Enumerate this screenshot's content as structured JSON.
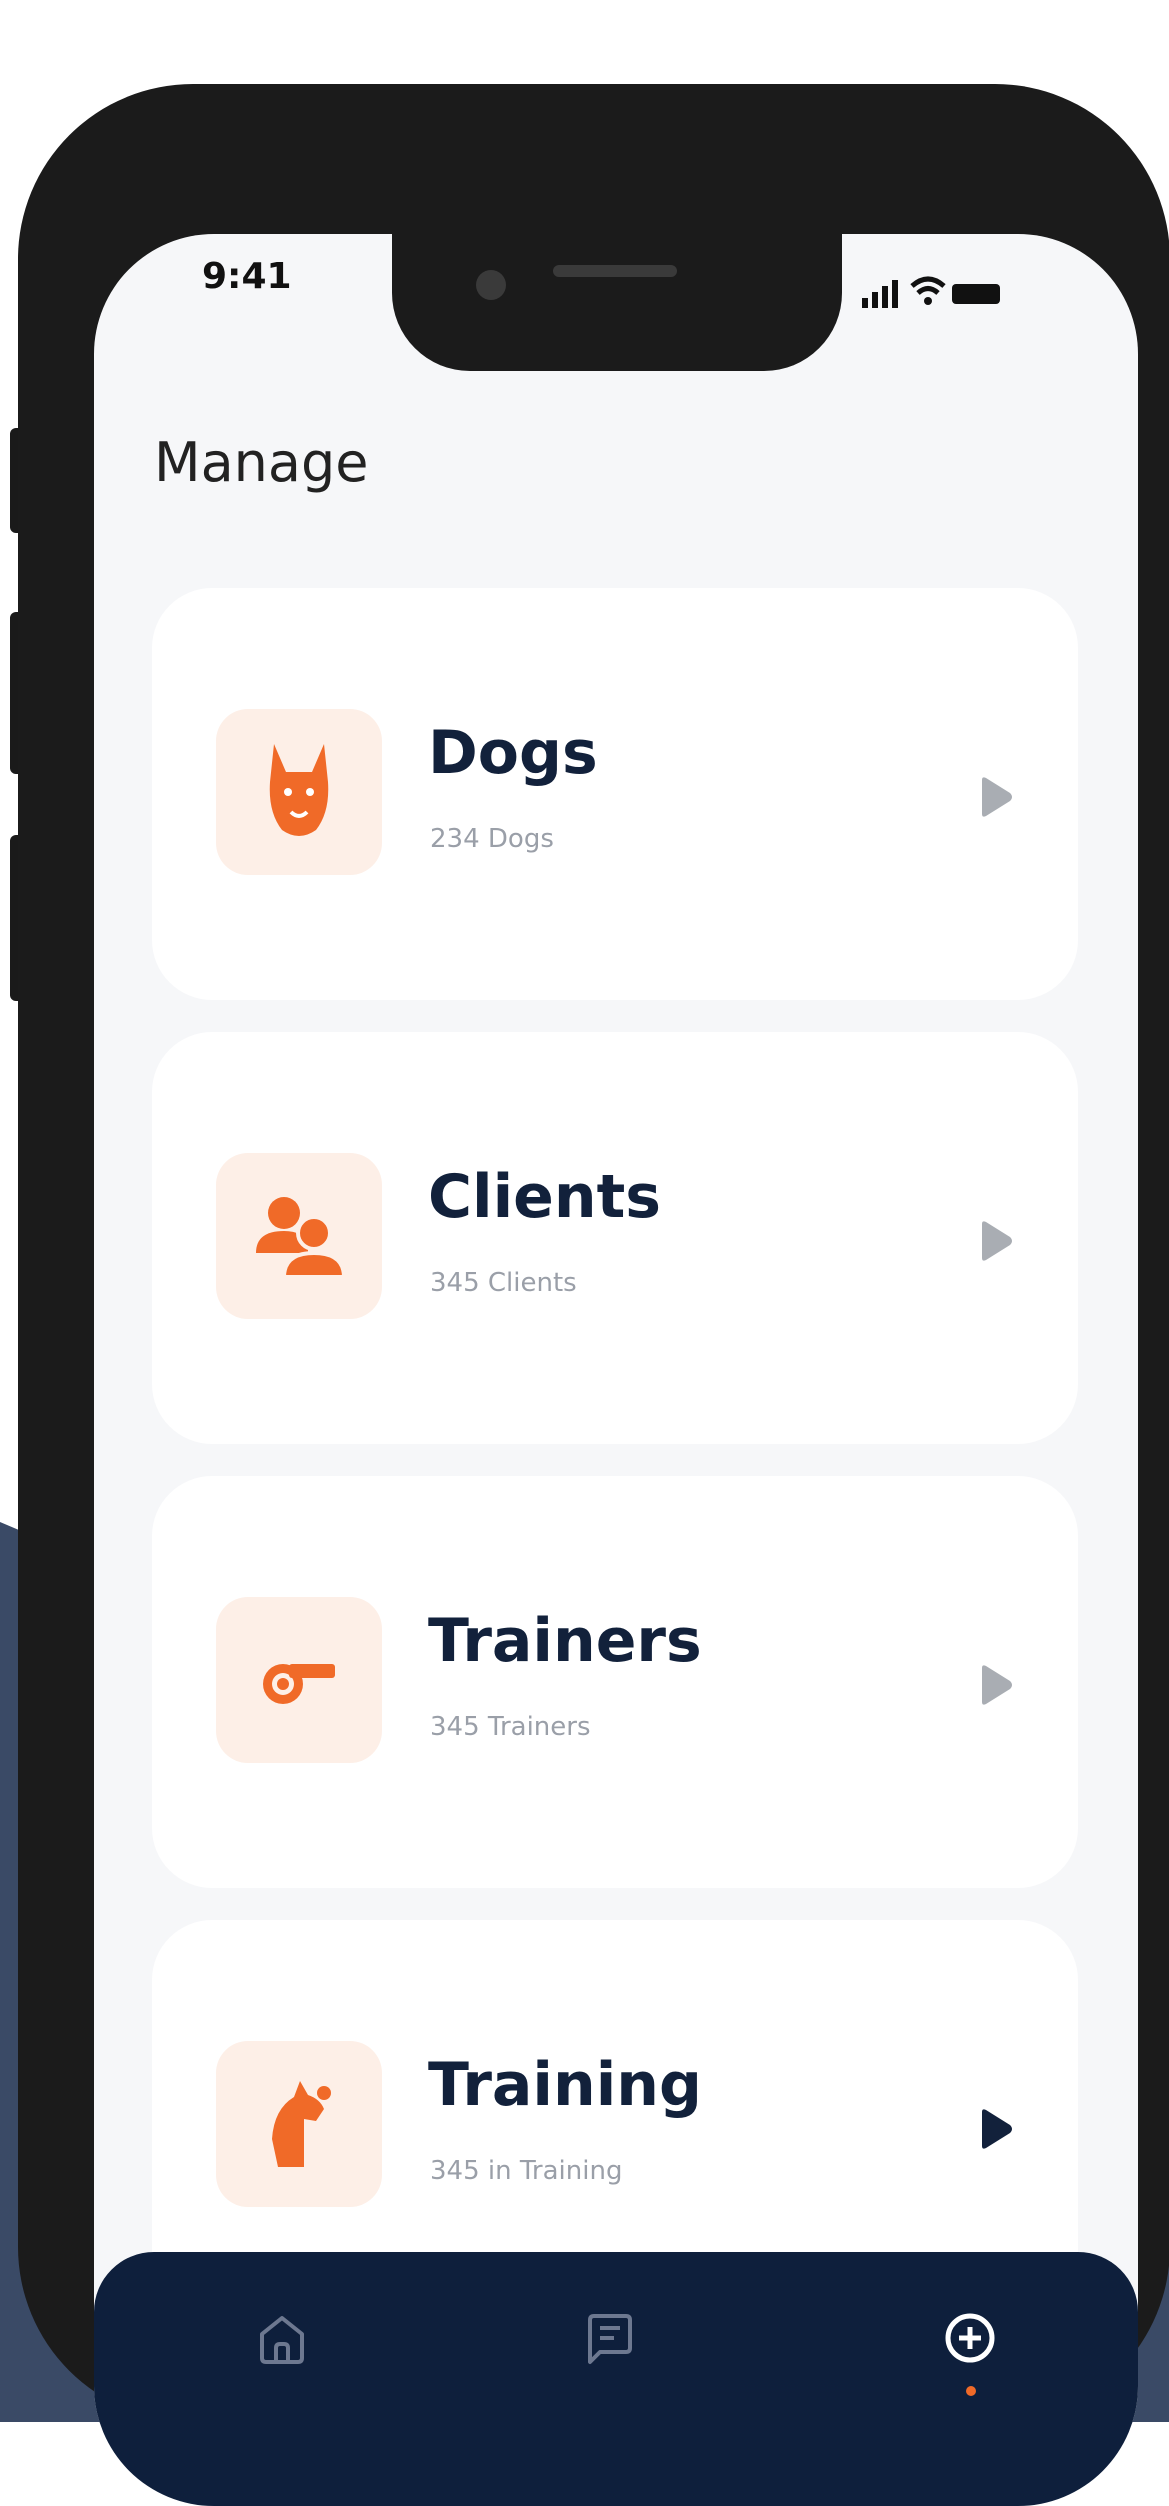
{
  "status_bar": {
    "time": "9:41"
  },
  "page": {
    "title": "Manage"
  },
  "cards": [
    {
      "label": "Dogs",
      "sub": "234 Dogs",
      "icon": "dog-icon",
      "active": false
    },
    {
      "label": "Clients",
      "sub": "345 Clients",
      "icon": "users-icon",
      "active": false
    },
    {
      "label": "Trainers",
      "sub": "345 Trainers",
      "icon": "whistle-icon",
      "active": false
    },
    {
      "label": "Training",
      "sub": "345 in Training",
      "icon": "dog-trick-icon",
      "active": true
    }
  ],
  "tabbar": {
    "items": [
      {
        "icon": "home-icon",
        "active": false
      },
      {
        "icon": "chat-icon",
        "active": false
      },
      {
        "icon": "plus-circle-icon",
        "active": true
      }
    ]
  },
  "colors": {
    "accent": "#f06a28",
    "icon_bg": "#fdefe7",
    "title_text": "#12213b",
    "sub_text": "#9a9fa8",
    "tabbar_bg": "#0e1f3c",
    "chevron_inactive": "#a9adb3",
    "chevron_active": "#12213b"
  }
}
